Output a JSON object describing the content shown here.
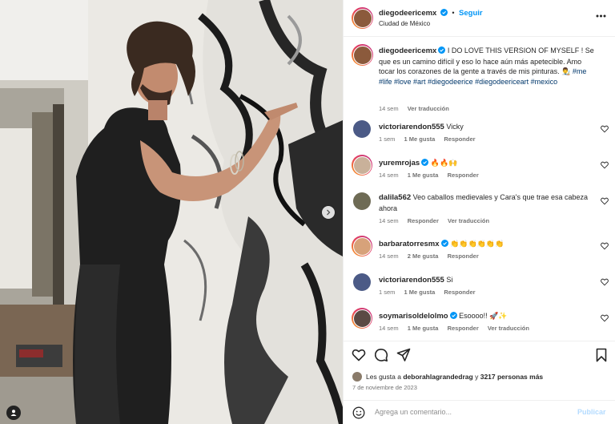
{
  "post": {
    "author": "diegodeericemx",
    "follow_label": "Seguir",
    "location": "Ciudad de México",
    "more_icon": "ellipsis-icon"
  },
  "caption": {
    "username": "diegodeericemx",
    "text_1": "I DO LOVE THIS VERSION OF MYSELF ! Se que es un camino difícil y eso lo hace aún más apetecible. Amo tocar los corazones de la gente a través de mis pinturas.",
    "emoji": "👨‍🎨",
    "hashtags": "#me #life #love #art #diegodeerice #diegodeericeart #mexico",
    "time": "14 sem",
    "translate": "Ver traducción"
  },
  "comments": [
    {
      "username": "victoriarendon555",
      "verified": false,
      "text": "Vicky",
      "time": "1 sem",
      "likes": "1 Me gusta",
      "reply": "Responder",
      "translate": ""
    },
    {
      "username": "yuremrojas",
      "verified": true,
      "text": "🔥🔥🙌",
      "time": "14 sem",
      "likes": "1 Me gusta",
      "reply": "Responder",
      "translate": ""
    },
    {
      "username": "dalila562",
      "verified": false,
      "text": "Veo caballos medievales y Cara's que trae esa cabeza ahora",
      "time": "14 sem",
      "likes": "",
      "reply": "Responder",
      "translate": "Ver traducción"
    },
    {
      "username": "barbaratorresmx",
      "verified": true,
      "text": "👏👏👏👏👏👏",
      "time": "14 sem",
      "likes": "2 Me gusta",
      "reply": "Responder",
      "translate": ""
    },
    {
      "username": "victoriarendon555",
      "verified": false,
      "text": "Si",
      "time": "1 sem",
      "likes": "1 Me gusta",
      "reply": "Responder",
      "translate": ""
    },
    {
      "username": "soymarisoldelolmo",
      "verified": true,
      "text": "Esoooo!! 🚀✨",
      "time": "14 sem",
      "likes": "1 Me gusta",
      "reply": "Responder",
      "translate": "Ver traducción"
    }
  ],
  "likes": {
    "prefix": "Les gusta a",
    "user": "deborahlagrandedrag",
    "joiner": "y",
    "others": "3217 personas más"
  },
  "date": "7 de noviembre de 2023",
  "add_comment": {
    "placeholder": "Agrega un comentario...",
    "publish": "Publicar"
  },
  "colors": {
    "link": "#0095f6",
    "hashtag": "#00376b",
    "muted": "#737373",
    "verified": "#0095f6"
  }
}
